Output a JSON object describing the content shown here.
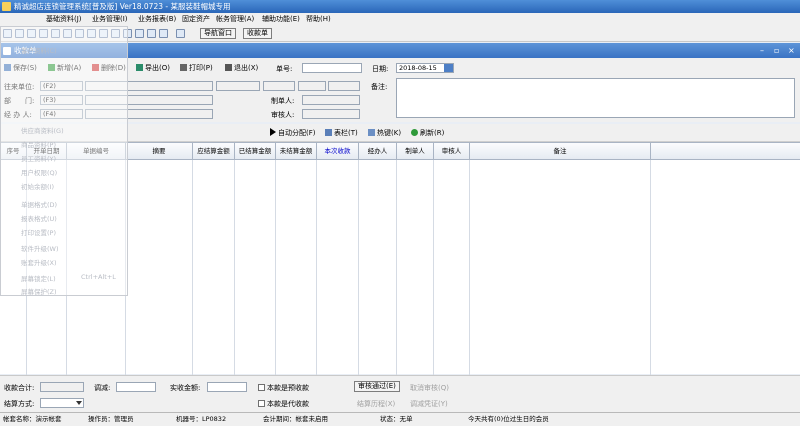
{
  "app": {
    "title": "精诚超店连锁管理系统[普及版] Ver18.0723 - 某服装鞋帽城专用"
  },
  "menu": [
    "基础资料(J)",
    "业务管理(I)",
    "业务报表(B)",
    "固定资产",
    "帐务管理(A)",
    "辅助功能(E)",
    "帮助(H)"
  ],
  "toolbar": {
    "nav_label": "导航窗口",
    "receipt_label": "收款单"
  },
  "window": {
    "title": "收款单",
    "controls": [
      "–",
      "▫",
      "×"
    ]
  },
  "form": {
    "buttons": {
      "save": "保存(S)",
      "add": "新增(A)",
      "delete": "删除(D)",
      "export": "导出(O)",
      "print": "打印(P)",
      "exit": "退出(X)"
    },
    "doc_no_label": "单号:",
    "doc_no": "",
    "date_label": "日期:",
    "date": "2018-08-15",
    "customer_label": "往来单位:",
    "customer_placeholder": "(F2)",
    "dept_label": "部　　门:",
    "dept_placeholder": "(F3)",
    "handler_label": "经 办 人:",
    "handler_placeholder": "(F4)",
    "maker_label": "制单人:",
    "reviewer_label": "审核人:",
    "remark_label": "备注:"
  },
  "actions": {
    "auto_alloc": "自动分配(F)",
    "columns": "表栏(T)",
    "hotkeys": "热键(K)",
    "refresh": "刷新(R)"
  },
  "table": {
    "columns": [
      "序号",
      "开单日期",
      "单据编号",
      "摘要",
      "应结算金额",
      "已结算金额",
      "未结算金额",
      "本次收款",
      "经办人",
      "制单人",
      "审核人",
      "备注"
    ]
  },
  "footer": {
    "receipt_total_label": "收款合计:",
    "adjust_label": "调减:",
    "actual_label": "实收金额:",
    "prepay_label": "本款是预收款",
    "agency_label": "本款是代收款",
    "settle_label": "结算方式:",
    "review_pass": "审核通过(E)",
    "cancel_review": "取消审核(Q)",
    "settle_history": "结算历程(X)",
    "adjust_voucher": "调减凭证(Y)"
  },
  "status": {
    "account": "帐套名称：演示帐套",
    "operator": "操作员：管理员",
    "machine": "机器号：LP0832",
    "period": "会计期间：帐套未启用",
    "state": "状态：无单",
    "birthday": "今天共有(0)位过生日的会员"
  },
  "overlay_menu": [
    "客户资料(C)",
    "供应商资料(G)",
    "商品资料(P)",
    "员工资料(Y)",
    "用户权限(Q)",
    "初始余额(I)",
    "单据格式(D)",
    "报表格式(U)",
    "打印设置(P)",
    "软件升级(W)",
    "账套升级(X)",
    "屏幕锁定(L)",
    "Ctrl+Alt+L",
    "屏幕保护(Z)"
  ],
  "colors": {
    "title_bar": "#2a66b8",
    "window_bar": "#3a73c4",
    "highlight_column": "#0000cc"
  }
}
